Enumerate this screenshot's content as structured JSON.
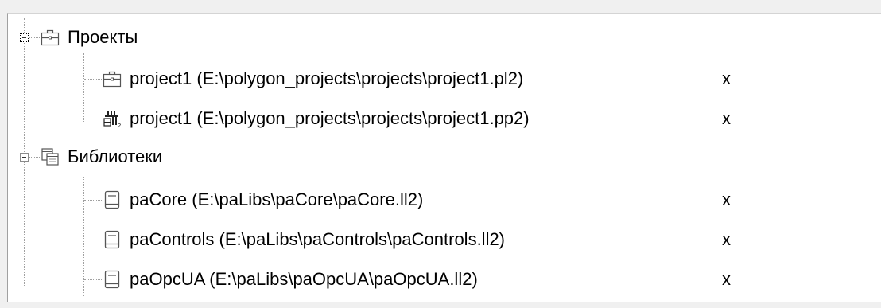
{
  "tree": {
    "groups": [
      {
        "label": "Проекты",
        "icon": "briefcase-icon",
        "expanded": true,
        "items": [
          {
            "label": "project1 (E:\\polygon_projects\\projects\\project1.pl2)",
            "icon": "briefcase-icon",
            "remove": "x"
          },
          {
            "label": "project1 (E:\\polygon_projects\\projects\\project1.pp2)",
            "icon": "project-structure-icon",
            "remove": "x"
          }
        ]
      },
      {
        "label": "Библиотеки",
        "icon": "libraries-icon",
        "expanded": true,
        "items": [
          {
            "label": "paCore (E:\\paLibs\\paCore\\paCore.ll2)",
            "icon": "library-book-icon",
            "remove": "x"
          },
          {
            "label": "paControls (E:\\paLibs\\paControls\\paControls.ll2)",
            "icon": "library-book-icon",
            "remove": "x"
          },
          {
            "label": "paOpcUA (E:\\paLibs\\paOpcUA\\paOpcUA.ll2)",
            "icon": "library-book-icon",
            "remove": "x"
          }
        ]
      }
    ]
  }
}
